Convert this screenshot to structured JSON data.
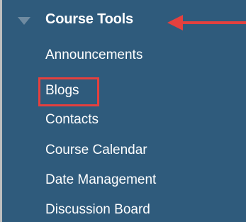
{
  "section": {
    "title": "Course Tools",
    "items": [
      {
        "label": "Announcements"
      },
      {
        "label": "Blogs"
      },
      {
        "label": "Contacts"
      },
      {
        "label": "Course Calendar"
      },
      {
        "label": "Date Management"
      },
      {
        "label": "Discussion Board"
      }
    ]
  },
  "colors": {
    "panel_background": "#2f5b7c",
    "text": "#ffffff",
    "annotation": "#e5403e"
  }
}
